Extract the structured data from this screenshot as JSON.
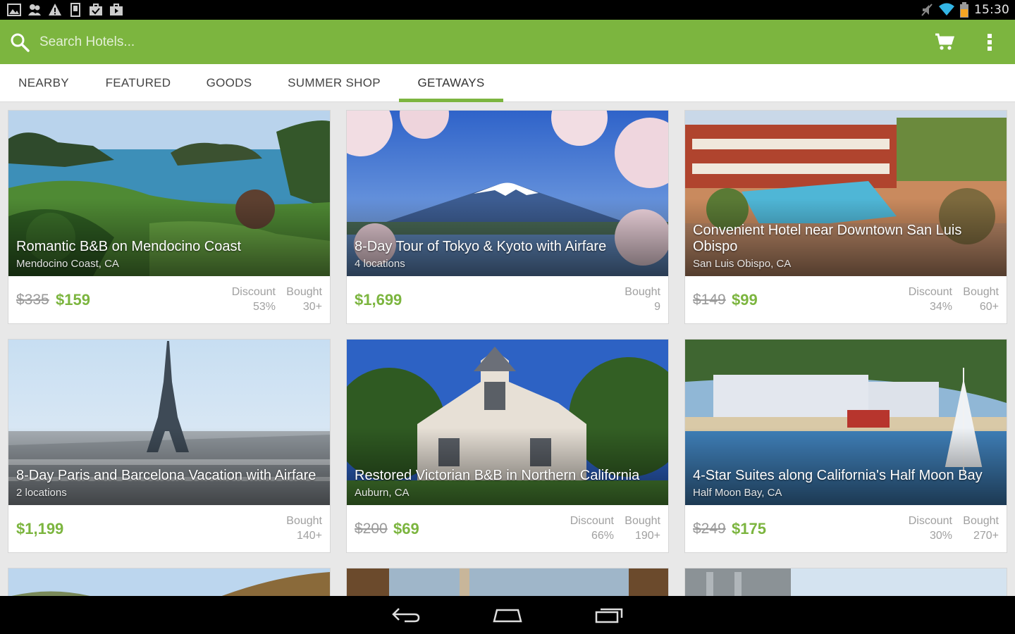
{
  "status_bar": {
    "time": "15:30",
    "left_icons": [
      "picture-icon",
      "app-icon",
      "warning-icon",
      "sim-icon",
      "briefcase-check-icon",
      "briefcase-play-icon"
    ],
    "right_icons": [
      "mute-icon",
      "wifi-icon",
      "battery-icon"
    ]
  },
  "action_bar": {
    "search_placeholder": "Search Hotels...",
    "icons": [
      "search-icon",
      "cart-icon",
      "overflow-menu-icon"
    ],
    "color": "#7cb53f"
  },
  "tabs": [
    {
      "label": "NEARBY",
      "active": false
    },
    {
      "label": "FEATURED",
      "active": false
    },
    {
      "label": "GOODS",
      "active": false
    },
    {
      "label": "SUMMER SHOP",
      "active": false
    },
    {
      "label": "GETAWAYS",
      "active": true
    }
  ],
  "deals": [
    {
      "title": "Romantic B&B on Mendocino Coast",
      "location": "Mendocino Coast, CA",
      "old_price": "$335",
      "price": "$159",
      "discount_label": "Discount",
      "discount": "53%",
      "bought_label": "Bought",
      "bought": "30+"
    },
    {
      "title": "8-Day Tour of Tokyo & Kyoto with Airfare",
      "location": "4 locations",
      "old_price": "",
      "price": "$1,699",
      "discount_label": "",
      "discount": "",
      "bought_label": "Bought",
      "bought": "9"
    },
    {
      "title": "Convenient Hotel near Downtown San Luis Obispo",
      "location": "San Luis Obispo, CA",
      "old_price": "$149",
      "price": "$99",
      "discount_label": "Discount",
      "discount": "34%",
      "bought_label": "Bought",
      "bought": "60+"
    },
    {
      "title": "8-Day Paris and Barcelona Vacation with Airfare",
      "location": "2 locations",
      "old_price": "",
      "price": "$1,199",
      "discount_label": "",
      "discount": "",
      "bought_label": "Bought",
      "bought": "140+"
    },
    {
      "title": "Restored Victorian B&B in Northern California",
      "location": "Auburn, CA",
      "old_price": "$200",
      "price": "$69",
      "discount_label": "Discount",
      "discount": "66%",
      "bought_label": "Bought",
      "bought": "190+"
    },
    {
      "title": "4-Star Suites along California's Half Moon Bay",
      "location": "Half Moon Bay, CA",
      "old_price": "$249",
      "price": "$175",
      "discount_label": "Discount",
      "discount": "30%",
      "bought_label": "Bought",
      "bought": "270+"
    }
  ],
  "nav_bar": {
    "icons": [
      "back-icon",
      "home-icon",
      "recent-apps-icon"
    ]
  }
}
